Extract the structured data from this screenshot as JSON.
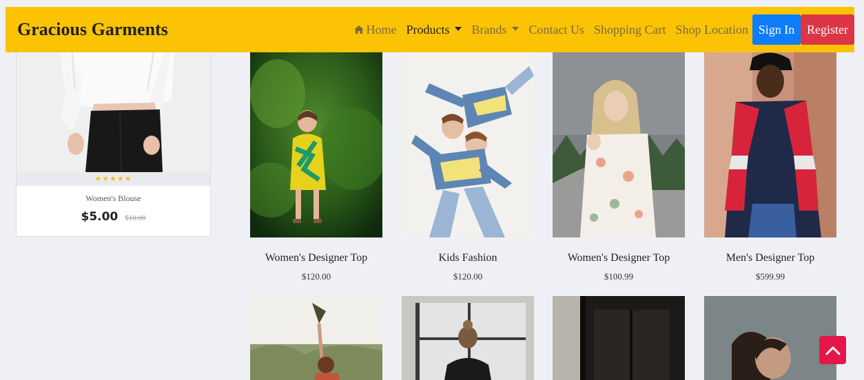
{
  "navbar": {
    "brand": "Gracious Garments",
    "links": [
      {
        "label": "Home",
        "icon": "home-icon"
      },
      {
        "label": "Products",
        "dropdown": true,
        "active": true
      },
      {
        "label": "Brands",
        "dropdown": true
      },
      {
        "label": "Contact Us"
      },
      {
        "label": "Shopping Cart"
      },
      {
        "label": "Shop Location"
      }
    ],
    "sign_in": "Sign In",
    "register": "Register",
    "colors": {
      "bar": "#fcc305",
      "sign_in": "#0d7dfa",
      "register": "#dc3545"
    }
  },
  "featured": {
    "stars": "★★★★★",
    "name": "Women's Blouse",
    "price": "$5.00",
    "old_price": "$10.00"
  },
  "products": [
    {
      "title": "Women's Designer Top",
      "price": "$120.00"
    },
    {
      "title": "Kids Fashion",
      "price": "$120.00"
    },
    {
      "title": "Women's Designer Top",
      "price": "$100.99"
    },
    {
      "title": "Men's Designer Top",
      "price": "$599.99"
    }
  ],
  "scroll_top": {
    "icon": "chevron-up-icon",
    "color": "#e5174a"
  }
}
